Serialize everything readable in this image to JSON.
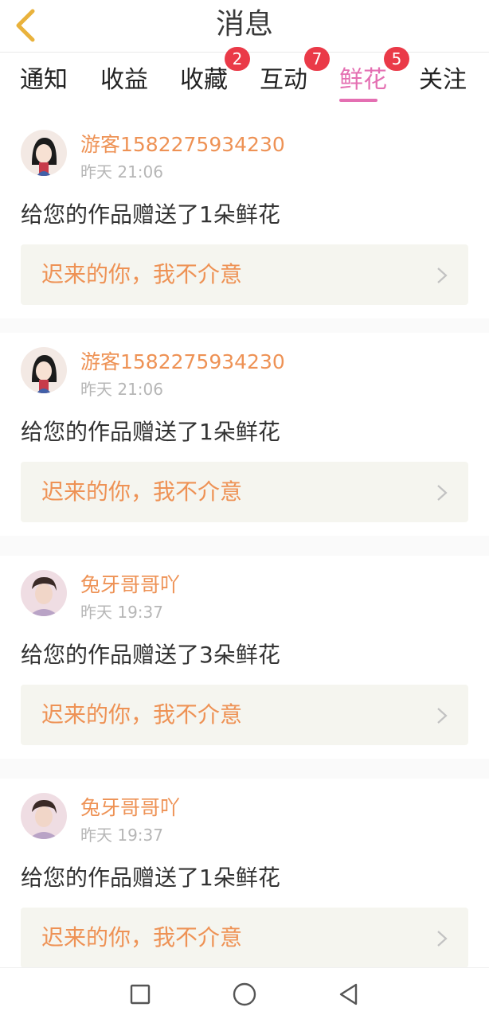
{
  "header": {
    "title": "消息"
  },
  "tabs": [
    {
      "label": "通知",
      "badge": ""
    },
    {
      "label": "收益",
      "badge": ""
    },
    {
      "label": "收藏",
      "badge": "2"
    },
    {
      "label": "互动",
      "badge": "7"
    },
    {
      "label": "鲜花",
      "badge": "5",
      "active": true
    },
    {
      "label": "关注",
      "badge": ""
    }
  ],
  "messages": [
    {
      "username": "游客1582275934230",
      "time": "昨天 21:06",
      "text": "给您的作品赠送了1朵鲜花",
      "work_title": "迟来的你，我不介意"
    },
    {
      "username": "游客1582275934230",
      "time": "昨天 21:06",
      "text": "给您的作品赠送了1朵鲜花",
      "work_title": "迟来的你，我不介意"
    },
    {
      "username": "兔牙哥哥吖",
      "time": "昨天 19:37",
      "text": "给您的作品赠送了3朵鲜花",
      "work_title": "迟来的你，我不介意"
    },
    {
      "username": "兔牙哥哥吖",
      "time": "昨天 19:37",
      "text": "给您的作品赠送了1朵鲜花",
      "work_title": "迟来的你，我不介意"
    }
  ],
  "colors": {
    "accent_pink": "#e46fb2",
    "username_orange": "#ee9255",
    "badge_red": "#ea3a48"
  }
}
